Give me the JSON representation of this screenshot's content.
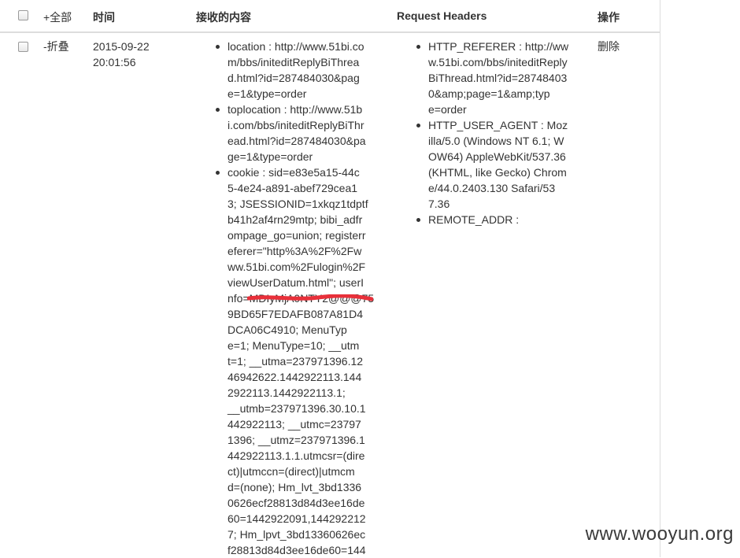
{
  "header": {
    "toggle_all": "+全部",
    "time": "时间",
    "content": "接收的内容",
    "request_headers": "Request Headers",
    "action": "操作"
  },
  "row": {
    "toggle": "-折叠",
    "time_lines": [
      "2015-09-22",
      "20:01:56"
    ],
    "content_items": [
      {
        "lines": [
          "location : http://www.51bi.co",
          "m/bbs/initeditReplyBiThrea",
          "d.html?id=287484030&pag",
          "e=1&type=order"
        ]
      },
      {
        "lines": [
          "toplocation : http://www.51b",
          "i.com/bbs/initeditReplyBiThr",
          "ead.html?id=287484030&pa",
          "ge=1&type=order"
        ]
      },
      {
        "lines": [
          "cookie : sid=e83e5a15-44c",
          "5-4e24-a891-abef729cea1",
          "3; JSESSIONID=1xkqz1tdptf",
          "b41h2af4rn29mtp; bibi_adfr",
          "ompage_go=union; registerr",
          "eferer=\"http%3A%2F%2Fw",
          "ww.51bi.com%2Fulogin%2F",
          "viewUserDatum.html\"; userI",
          "nfo=MDIyMjA0NTY2@@@75",
          "9BD65F7EDAFB087A81D4",
          "DCA06C4910; MenuTyp",
          "e=1; MenuType=10; __utm",
          "t=1; __utma=237971396.12",
          "46942622.1442922113.144",
          "2922113.1442922113.1;",
          "__utmb=237971396.30.10.1",
          "442922113; __utmc=23797",
          "1396; __utmz=237971396.1",
          "442922113.1.1.utmcsr=(dire",
          "ct)|utmccn=(direct)|utmcm",
          "d=(none); Hm_lvt_3bd1336",
          "0626ecf28813d84d3ee16de",
          "60=1442922091,144292212",
          "7; Hm_lpvt_3bd13360626ec",
          "f28813d84d3ee16de60=144"
        ]
      }
    ],
    "header_items": [
      {
        "lines": [
          "HTTP_REFERER : http://ww",
          "w.51bi.com/bbs/initeditReply",
          "BiThread.html?id=28748403",
          "0&amp;page=1&amp;typ",
          "e=order"
        ]
      },
      {
        "lines": [
          "HTTP_USER_AGENT : Moz",
          "illa/5.0 (Windows NT 6.1; W",
          "OW64) AppleWebKit/537.36",
          "(KHTML, like Gecko) Chrom",
          "e/44.0.2403.130 Safari/53",
          "7.36"
        ]
      },
      {
        "lines": [
          "REMOTE_ADDR :"
        ]
      }
    ],
    "action_label": "删除"
  },
  "watermark": "www.wooyun.org",
  "colors": {
    "border": "#dddddd",
    "text": "#333333",
    "redaction": "#e8303a"
  }
}
